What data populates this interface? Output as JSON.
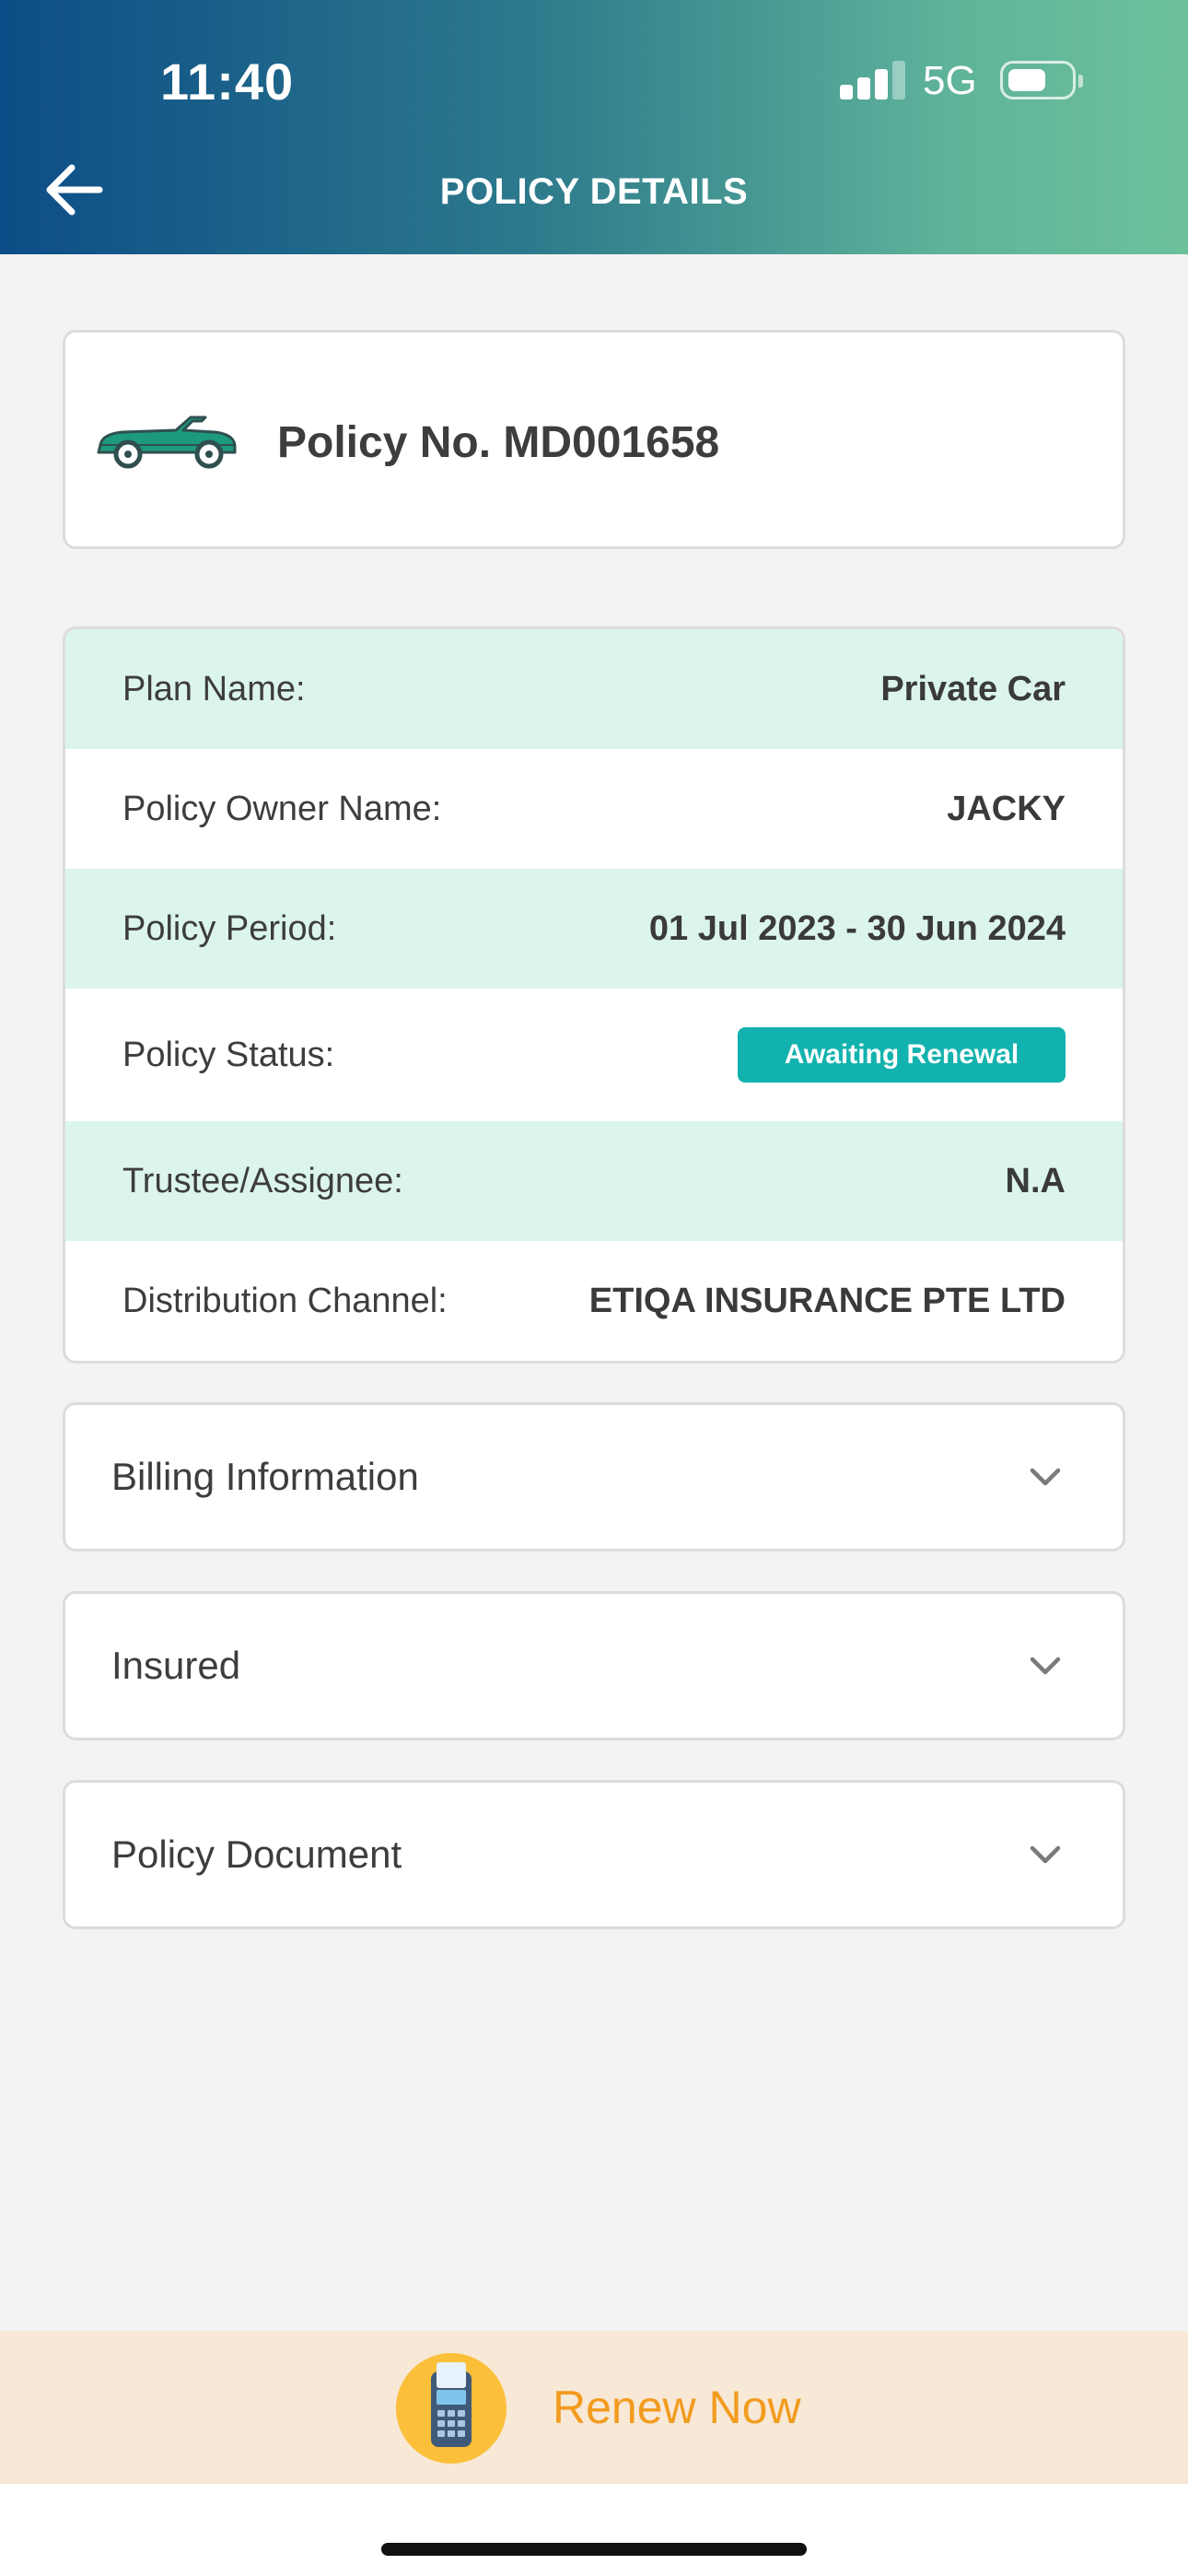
{
  "status_bar": {
    "time": "11:40",
    "network": "5G"
  },
  "header": {
    "title": "POLICY DETAILS"
  },
  "policy": {
    "number_label": "Policy No. MD001658",
    "vehicle_icon": "car-icon"
  },
  "details": [
    {
      "label": "Plan Name:",
      "value": "Private Car"
    },
    {
      "label": "Policy Owner Name:",
      "value": "JACKY"
    },
    {
      "label": "Policy Period:",
      "value": "01 Jul 2023 - 30 Jun 2024"
    },
    {
      "label": "Policy Status:",
      "value": "Awaiting Renewal"
    },
    {
      "label": "Trustee/Assignee:",
      "value": "N.A"
    },
    {
      "label": "Distribution Channel:",
      "value": "ETIQA INSURANCE PTE LTD"
    }
  ],
  "sections": [
    {
      "label": "Billing Information"
    },
    {
      "label": "Insured"
    },
    {
      "label": "Policy Document"
    }
  ],
  "renew": {
    "label": "Renew Now"
  },
  "colors": {
    "header_start": "#0c4d87",
    "header_end": "#6cc19b",
    "row_shade": "#dcf4ee",
    "status_badge": "#12b2ae",
    "renew_bg": "#f8e8d6",
    "renew_text": "#f29b1e"
  }
}
